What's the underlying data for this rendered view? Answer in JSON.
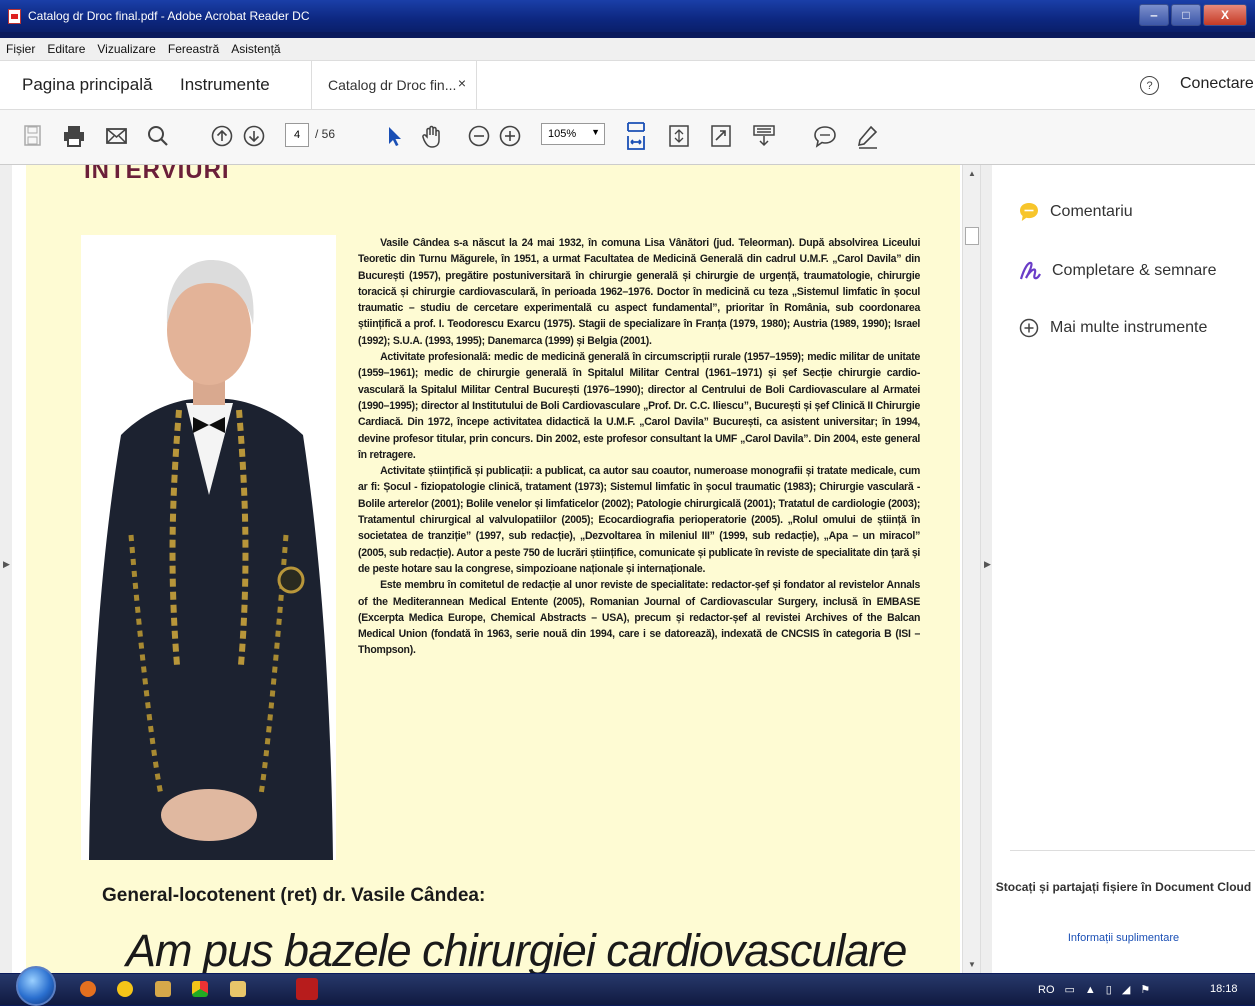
{
  "window": {
    "title": "Catalog dr Droc final.pdf - Adobe Acrobat Reader DC",
    "min": "‒",
    "max": "□",
    "close": "X"
  },
  "menu": [
    "Fișier",
    "Editare",
    "Vizualizare",
    "Fereastră",
    "Asistență"
  ],
  "tabs": {
    "home": "Pagina principală",
    "tools": "Instrumente",
    "doc": "Catalog dr Droc fin...",
    "doc_close": "×",
    "help": "?",
    "connect": "Conectare"
  },
  "toolbar": {
    "page_current": "4",
    "page_total": "/ 56",
    "zoom": "105%",
    "zoom_caret": "▼"
  },
  "document": {
    "section_heading": "INTERVIURI",
    "bio_p1": "Vasile Cândea s-a născut la 24 mai 1932, în comuna Lisa Vânători (jud. Teleorman). După absolvirea Liceului Teoretic din Turnu Măgurele, în 1951, a urmat Facultatea de Medicină Generală din cadrul U.M.F. „Carol Davila” din București (1957), pregătire postuniversitară în chirurgie generală și chirurgie de urgență, traumatologie, chirurgie toracică și chirurgie cardiovasculară, în perioada 1962–1976. Doctor în medicină cu teza „Sistemul limfatic în șocul traumatic – studiu de cercetare experimentală cu aspect fundamental”, prioritar în România, sub coordonarea științifică a prof. I. Teodorescu Exarcu (1975). Stagii de specializare în Franța (1979, 1980); Austria (1989, 1990); Israel (1992); S.U.A. (1993, 1995); Danemarca (1999) și Belgia (2001).",
    "bio_p2": "Activitate profesională: medic de medicină generală în circumscripții rurale (1957–1959); medic militar de unitate (1959–1961); medic de chirurgie generală în Spitalul Militar Central (1961–1971) și șef Secție chirurgie cardio-vasculară la Spitalul Militar Central București (1976–1990); director al Centrului de Boli Cardiovasculare al Armatei (1990–1995); director al Institutului de Boli Cardiovasculare „Prof. Dr. C.C. Iliescu”, București și șef Clinică II Chirurgie Cardiacă. Din 1972, începe activitatea didactică la U.M.F. „Carol Davila” București, ca asistent universitar; în 1994, devine profesor titular, prin concurs. Din 2002, este profesor consultant la UMF „Carol Davila”. Din 2004, este general în retragere.",
    "bio_p3": "Activitate științifică și publicații: a publicat, ca autor sau coautor, numeroase monografii și tratate medicale, cum ar fi: Șocul - fiziopatologie clinică, tratament (1973); Sistemul limfatic în șocul traumatic (1983); Chirurgie vasculară - Bolile arterelor (2001); Bolile venelor și limfaticelor (2002); Patologie chirurgicală (2001); Tratatul de cardiologie (2003); Tratamentul chirurgical al valvulopatiilor (2005); Ecocardiografia perioperatorie (2005). „Rolul omului de știință în societatea de tranziție” (1997, sub redacție), „Dezvoltarea în mileniul III” (1999, sub redacție), „Apa – un miracol” (2005, sub redacție). Autor a peste 750 de lucrări științifice, comunicate și publicate în reviste de specialitate din țară și de peste hotare sau la congrese, simpozioane naționale și internaționale.",
    "bio_p4": "Este membru în comitetul de redacție al unor reviste de specialitate: redactor-șef și fondator al revistelor Annals of the Mediterannean Medical Entente (2005), Romanian Journal of Cardiovascular Surgery, inclusă în EMBASE (Excerpta Medica Europe, Chemical Abstracts – USA), precum și redactor-șef al revistei Archives of the Balcan Medical Union (fondată în 1963, serie nouă din 1994, care i se datorează), indexată de CNCSIS în categoria B (ISI – Thompson).",
    "subtitle": "General-locotenent (ret) dr. Vasile Cândea:",
    "headline": "Am pus bazele chirurgiei cardiovasculare"
  },
  "right_panel": {
    "comment": "Comentariu",
    "fill_sign": "Completare & semnare",
    "more_tools": "Mai multe instrumente",
    "cloud_text": "Stocați și partajați fișiere în Document Cloud",
    "cloud_link": "Informații suplimentare"
  },
  "taskbar": {
    "lang": "RO",
    "time": "18:18"
  },
  "colors": {
    "page_bg": "#fefbd3",
    "heading": "#6b1f3a",
    "accent": "#1a4fb5",
    "titlebar": "#0d2780"
  }
}
